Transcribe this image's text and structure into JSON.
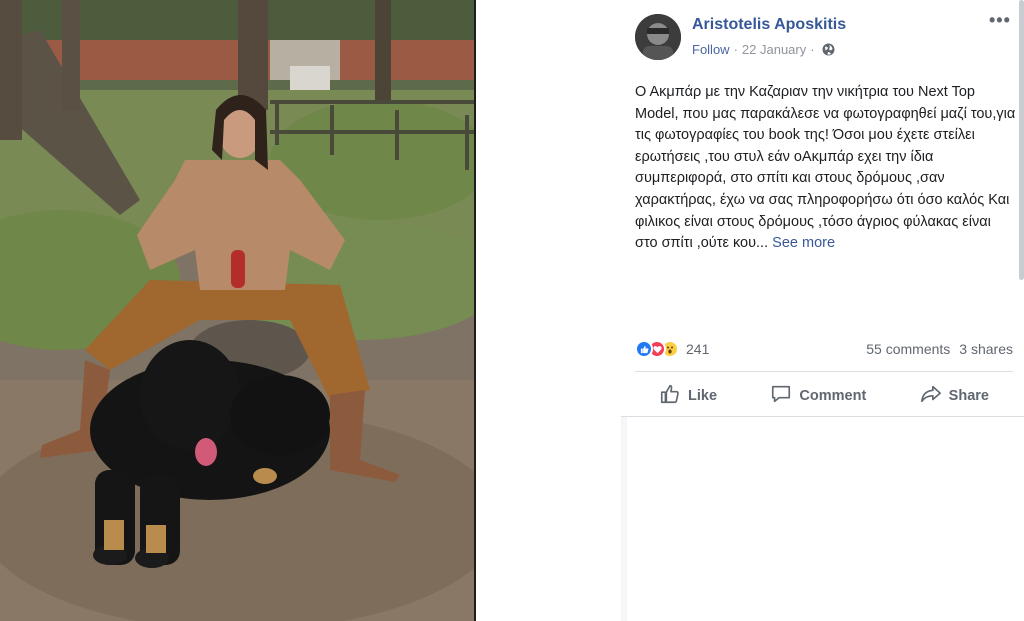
{
  "photo": {
    "alt_icon": "photo-image"
  },
  "post": {
    "author": "Aristotelis Aposkitis",
    "follow_label": "Follow",
    "separator": "·",
    "date": "22 January",
    "privacy_icon": "globe-icon",
    "more_icon": "•••",
    "text": "Ο Ακμπάρ με την Καζαριαν την νικήτρια του Next Top Model, που μας παρακάλεσε να φωτογραφηθεί μαζί του,για τις φωτογραφίες του book της! Όσοι μου έχετε στείλει ερωτήσεις ,του στυλ εάν οΑκμπάρ εχει την ίδια συμπεριφορά, στο σπίτι και στους δρόμους ,σαν χαρακτήρας, έχω να σας πληροφορήσω ότι όσο καλός Και φιλικος είναι στους δρόμους ,τόσο άγριος φύλακας είναι στο σπίτι ,ούτε κου...",
    "see_more": "See more"
  },
  "reactions": {
    "icons": [
      "like-reaction",
      "love-reaction",
      "wow-reaction"
    ],
    "count": "241",
    "comments": "55 comments",
    "shares": "3 shares"
  },
  "actions": {
    "like": "Like",
    "comment": "Comment",
    "share": "Share"
  },
  "colors": {
    "link": "#365899",
    "meta": "#90949c",
    "like_blue": "#2078f4",
    "love_red": "#f33e58",
    "wow_yellow": "#fccf42"
  }
}
